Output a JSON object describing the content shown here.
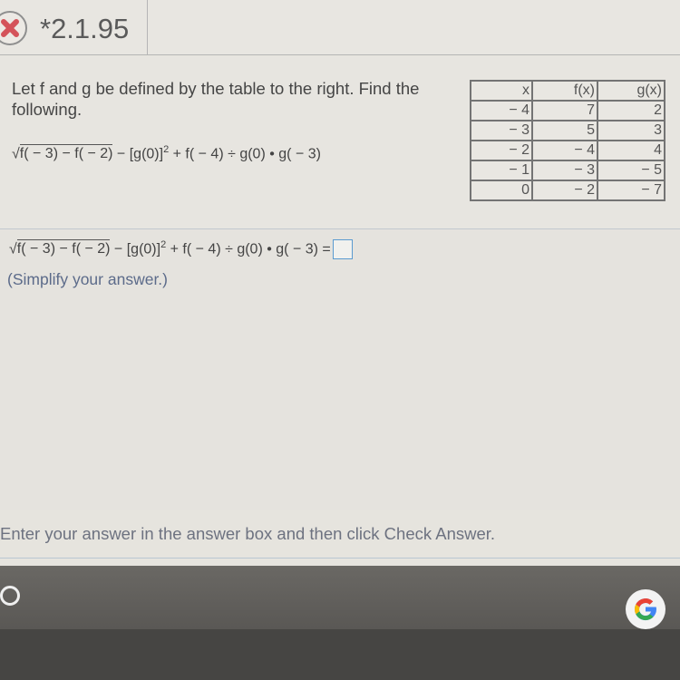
{
  "header": {
    "status_icon": "incorrect-x-icon",
    "problem_id": "*2.1.95"
  },
  "question": {
    "prompt": "Let f and g be defined by the table to the right.  Find the following.",
    "expression": {
      "radicand": "f( − 3) − f( − 2)",
      "rest_before_exp": " − [g(0)]",
      "exponent": "2",
      "rest_after_exp": " + f( − 4) ÷ g(0) • g( − 3)"
    },
    "table": {
      "headers": [
        "x",
        "f(x)",
        "g(x)"
      ],
      "rows": [
        [
          "− 4",
          "7",
          "2"
        ],
        [
          "− 3",
          "5",
          "3"
        ],
        [
          "− 2",
          "− 4",
          "4"
        ],
        [
          "− 1",
          "− 3",
          "− 5"
        ],
        [
          "0",
          "− 2",
          "− 7"
        ]
      ]
    }
  },
  "answer": {
    "equals": " =",
    "value": "",
    "hint": "(Simplify your answer.)"
  },
  "instruction": "Enter your answer in the answer box and then click Check Answer.",
  "taskbar": {
    "launcher_icon": "launcher-circle-icon",
    "app_icon": "google-icon"
  }
}
